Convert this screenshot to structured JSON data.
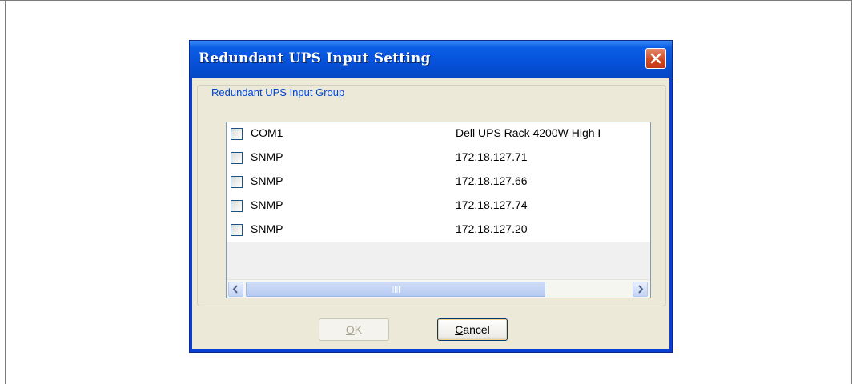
{
  "dialog": {
    "title": "Redundant UPS Input Setting",
    "group_label": "Redundant UPS Input Group"
  },
  "list": {
    "rows": [
      {
        "checked": false,
        "type": "COM1",
        "device": "Dell UPS Rack 4200W High I"
      },
      {
        "checked": false,
        "type": "SNMP",
        "device": "172.18.127.71"
      },
      {
        "checked": false,
        "type": "SNMP",
        "device": "172.18.127.66"
      },
      {
        "checked": false,
        "type": "SNMP",
        "device": "172.18.127.74"
      },
      {
        "checked": false,
        "type": "SNMP",
        "device": "172.18.127.20"
      }
    ]
  },
  "buttons": {
    "ok": {
      "mnemonic": "O",
      "rest": "K",
      "enabled": false
    },
    "cancel": {
      "mnemonic": "C",
      "rest": "ancel",
      "enabled": true
    }
  },
  "icons": {
    "close": "close-icon",
    "scroll_left": "arrow-left-icon",
    "scroll_right": "arrow-right-icon",
    "thumb_grip": "grip-icon"
  },
  "colors": {
    "titlebar": "#0651d9",
    "close_button": "#d0461f",
    "group_label": "#0046d5",
    "client": "#ece9d8"
  }
}
